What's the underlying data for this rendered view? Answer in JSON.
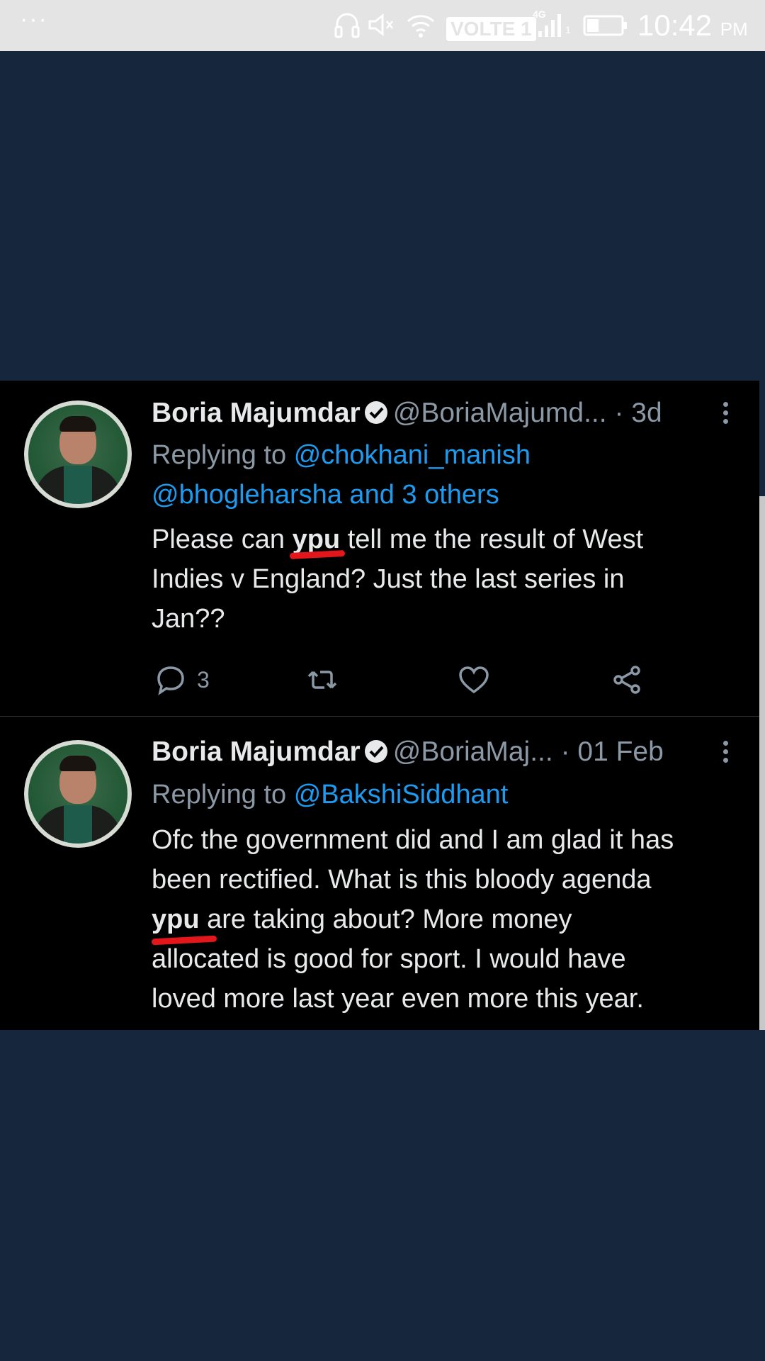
{
  "status_bar": {
    "dots": "···",
    "volte": "VOLTE 1",
    "network": "4G",
    "sim": "1",
    "time": "10:42",
    "ampm": "PM",
    "icons": [
      "headphones-icon",
      "mute-icon",
      "wifi-icon",
      "signal-icon",
      "battery-icon"
    ]
  },
  "tweets": [
    {
      "name": "Boria Majumdar",
      "handle": "@BoriaMajumd...",
      "time": "· 3d",
      "replying_prefix": "Replying to",
      "replying_to": "@chokhani_manish",
      "replying_more": "@bhogleharsha and 3 others",
      "text_before": "Please can",
      "text_typo": "ypu",
      "text_line1_after": "tell me the result of West",
      "text_line2": "Indies v England? Just the last series in",
      "text_line3": "Jan??",
      "reply_count": "3"
    },
    {
      "name": "Boria Majumdar",
      "handle": "@BoriaMaj...",
      "time": "· 01 Feb",
      "replying_prefix": "Replying to",
      "replying_to": "@BakshiSiddhant",
      "text_line1": "Ofc the government did and I am glad it has",
      "text_line2": "been rectified. What is this bloody agenda",
      "text_typo": "ypu",
      "text_line3_after": "are taking about? More money",
      "text_line4": "allocated is good for sport. I would have",
      "text_line5": "loved more last year even more this year."
    }
  ],
  "colors": {
    "page_background": "#16263d",
    "card_background": "#000000",
    "mention": "#1d9bf0",
    "muted": "#8b98a5",
    "highlight_underline": "#e2161b"
  }
}
